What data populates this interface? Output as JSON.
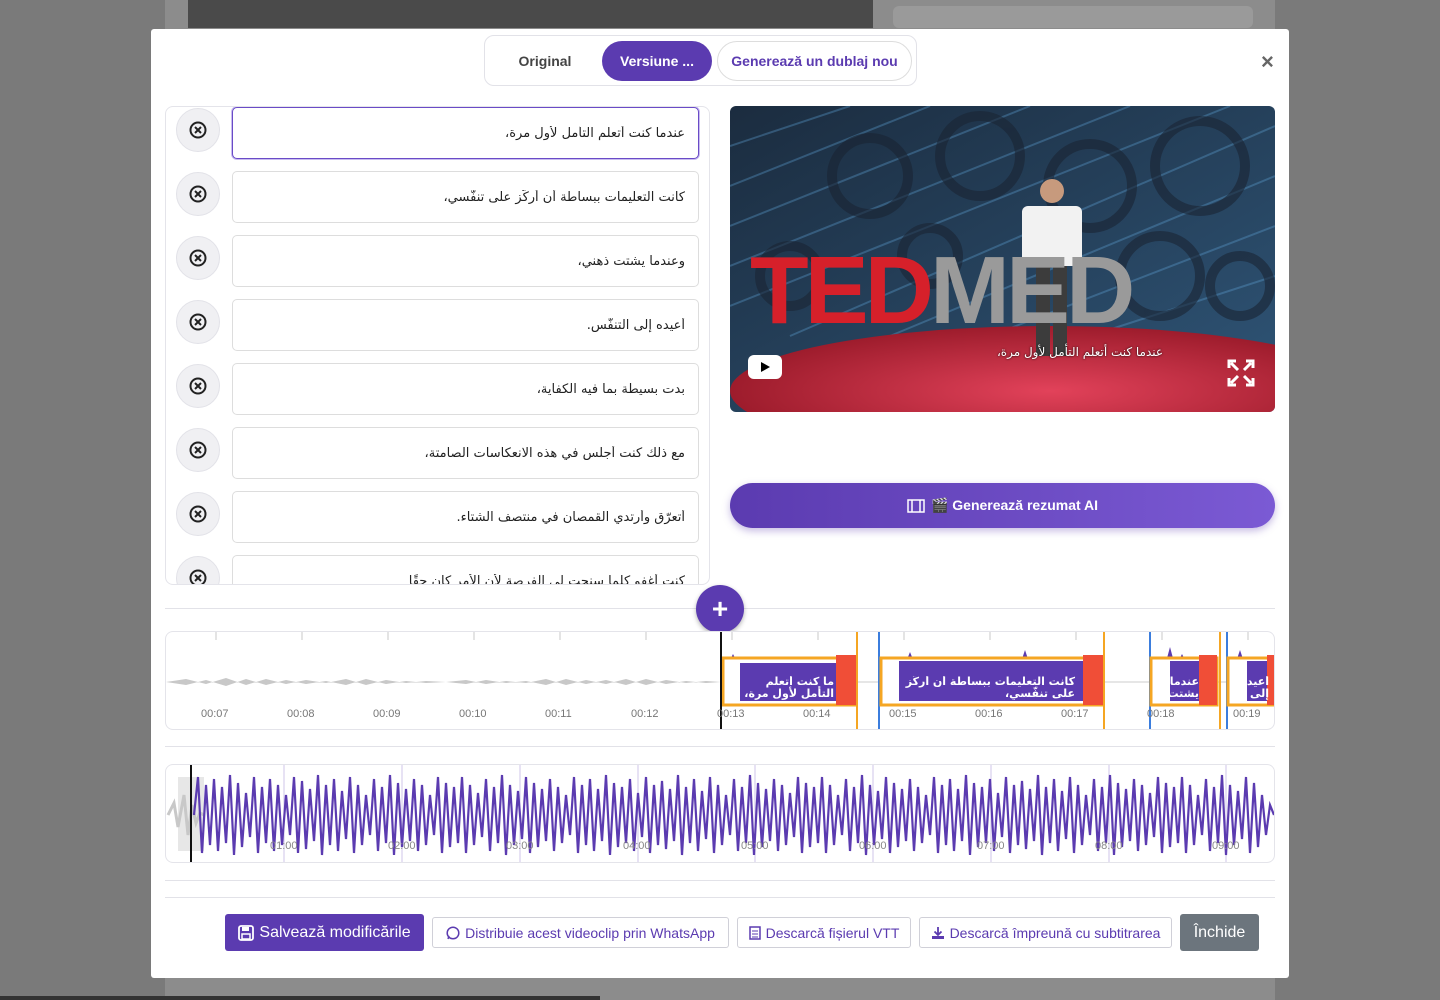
{
  "tabs": {
    "original": "Original",
    "version": "Versiune ...",
    "new_dub": "Generează un dublaj nou"
  },
  "close_label": "×",
  "segments": [
    "عندما كنت أتعلم التأمل لأول مرة،",
    "كانت التعليمات ببساطة أن أركّز على تنفّسي،",
    "وعندما يشتت ذهني،",
    "أعيده إلى التنفّس.",
    "بدت بسيطة بما فيه الكفاية،",
    "مع ذلك كنت أجلس في هذه الانعكاسات الصامتة،",
    "أتعرّق وأرتدي القمصان في منتصف الشتاء.",
    "كنت أغفو كلما سنحت لي الفرصة لأن الأمر كان حقًا"
  ],
  "video": {
    "subtitle": "عندما كنت أتعلم التأمل لأول مرة،",
    "brand_red": "TED",
    "brand_grey": "MED"
  },
  "ai_button": {
    "label": "🎬 Generează rezumat AI"
  },
  "add_label": "+",
  "timeline": {
    "ticks": [
      "00:07",
      "00:08",
      "00:09",
      "00:10",
      "00:11",
      "00:12",
      "00:13",
      "00:14",
      "00:15",
      "00:16",
      "00:17",
      "00:18",
      "00:19"
    ],
    "clips": [
      "ما كنت أتعلم التأمل لأول مرة،",
      "كانت التعليمات ببساطة أن أركّز على تنفّسي،",
      "عندما يشتت",
      "أعيده إلى"
    ]
  },
  "overview": {
    "ticks": [
      "01:00",
      "02:00",
      "03:00",
      "04:00",
      "05:00",
      "06:00",
      "07:00",
      "08:00",
      "09:00"
    ]
  },
  "actions": {
    "save": "Salvează modificările",
    "whatsapp": "Distribuie acest videoclip prin WhatsApp",
    "vtt": "Descarcă fișierul VTT",
    "download": "Descarcă împreună cu subtitrarea",
    "close": "Închide"
  },
  "colors": {
    "accent": "#5b3bb0",
    "clip_border": "#f5a623",
    "clip_end": "#f04e37",
    "grey_button": "#6c757d"
  }
}
